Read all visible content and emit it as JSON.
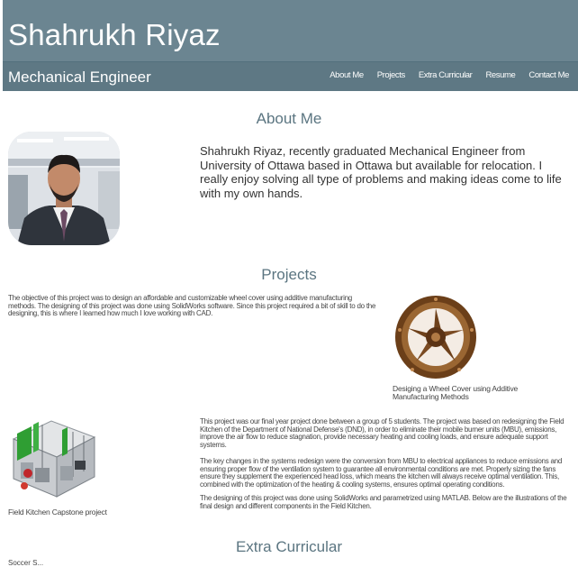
{
  "header": {
    "title": "Shahrukh Riyaz",
    "subtitle": "Mechanical Engineer",
    "nav": [
      "About Me",
      "Projects",
      "Extra Curricular",
      "Resume",
      "Contact Me"
    ]
  },
  "about": {
    "heading": "About Me",
    "text": "Shahrukh Riyaz, recently graduated Mechanical Engineer from University of Ottawa based in Ottawa but available for relocation. I really enjoy solving all type of problems and making ideas come to life with my own hands."
  },
  "projects": {
    "heading": "Projects",
    "wheel": {
      "description": "The objective of this project was to design an affordable and customizable wheel cover using additive manufacturing methods. The designing of this project was done using SolidWorks software. Since this project required a bit of skill to do the designing, this is where I learned how much I love working with CAD.",
      "caption": "Desiging a Wheel Cover using Additive Manufacturing Methods"
    },
    "kitchen": {
      "caption": "Field Kitchen Capstone project",
      "paragraphs": [
        "This project was our final year project done between a group of 5 students. The project was based on redesigning the Field Kitchen of the Department of National Defense's (DND), in order to eliminate their mobile burner units (MBU), emissions, improve the air flow to reduce stagnation, provide necessary heating and cooling loads, and ensure adequate support systems.",
        "The key changes in the systems redesign were the conversion from MBU to electrical appliances to reduce emissions and ensuring proper flow of the ventilation system to guarantee all environmental conditions are met. Properly sizing the fans ensure they supplement the experienced head loss, which means the kitchen will always receive optimal ventilation. This, combined with the optimization of the heating & cooling systems, ensures optimal operating conditions.",
        "The designing of this project was done using SolidWorks and parametrized using MATLAB. Below are the illustrations of the final design and different components in the Field Kitchen."
      ]
    }
  },
  "extra": {
    "heading": "Extra Curricular",
    "cut_text": "Soccer S..."
  }
}
